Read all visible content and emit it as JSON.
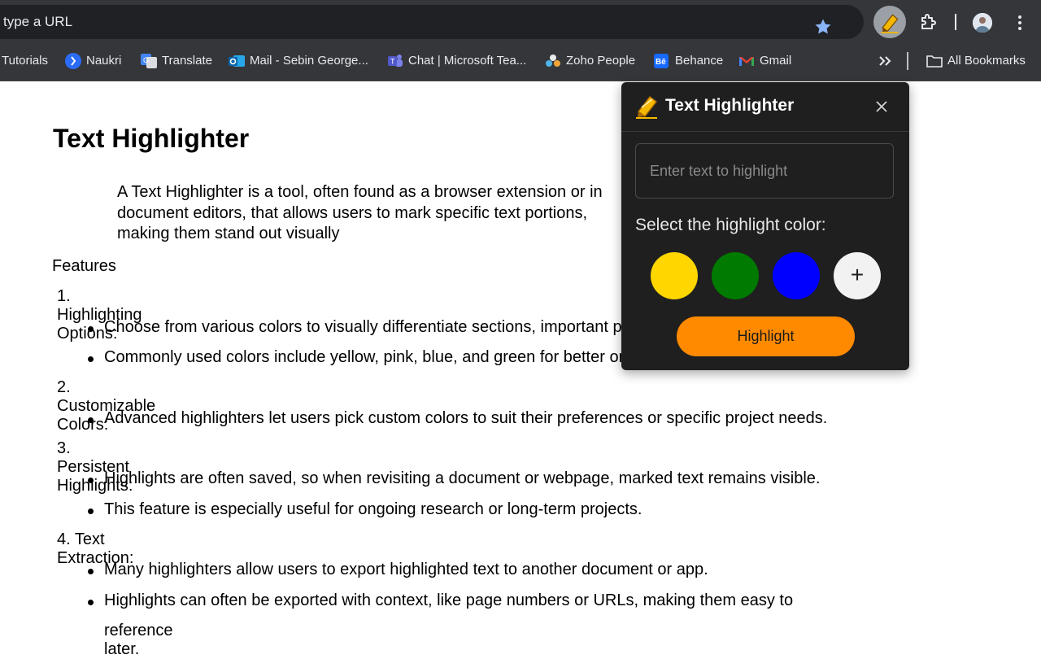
{
  "browser": {
    "omnibox": {
      "placeholder": "type a URL"
    },
    "bookmarks": [
      {
        "label": "Tutorials",
        "icon": "none"
      },
      {
        "label": "Naukri",
        "icon": "naukri-icon"
      },
      {
        "label": "Translate",
        "icon": "google-translate-icon"
      },
      {
        "label": "Mail - Sebin George...",
        "icon": "outlook-icon"
      },
      {
        "label": "Chat | Microsoft Tea...",
        "icon": "teams-icon"
      },
      {
        "label": "Zoho People",
        "icon": "zoho-icon"
      },
      {
        "label": "Behance",
        "icon": "behance-icon"
      },
      {
        "label": "Gmail",
        "icon": "gmail-icon"
      }
    ],
    "all_bookmarks": "All Bookmarks",
    "colors": {
      "toolbar": "#35363a",
      "omnibox": "#202124",
      "star": "#8ab4f8"
    }
  },
  "page": {
    "title": "Text Highlighter",
    "intro": "A Text Highlighter is a tool, often found as a browser extension or in document editors, that allows users to mark specific text portions, making them stand out visually",
    "features_label": "Features",
    "features": [
      {
        "number": "1.",
        "title": "Highlighting Options:",
        "bullets": [
          "Choose from various colors to visually differentiate sections, important points, or themes.",
          "Commonly used colors include yellow, pink, blue, and green for better organization."
        ]
      },
      {
        "number": "2.",
        "title": "Customizable Colors:",
        "bullets": [
          "Advanced highlighters let users pick custom colors to suit their preferences or specific project needs."
        ]
      },
      {
        "number": "3.",
        "title": "Persistent Highlights:",
        "bullets": [
          "Highlights are often saved, so when revisiting a document or webpage, marked text remains visible.",
          "This feature is especially useful for ongoing research or long-term projects."
        ]
      },
      {
        "number": "4.",
        "title": "Text Extraction:",
        "bullets": [
          "Many highlighters allow users to export highlighted text to another document or app.",
          "Highlights can often be exported with context, like page numbers or URLs, making them easy to"
        ],
        "continuation": "reference later."
      }
    ]
  },
  "popup": {
    "title": "Text Highlighter",
    "input_placeholder": "Enter text to highlight",
    "color_label": "Select the highlight color:",
    "swatches": [
      {
        "name": "yellow",
        "color": "#ffd600"
      },
      {
        "name": "green",
        "color": "#007a00"
      },
      {
        "name": "blue",
        "color": "#0000ff"
      }
    ],
    "add_symbol": "+",
    "button_label": "Highlight",
    "button_color": "#ff8a00"
  }
}
